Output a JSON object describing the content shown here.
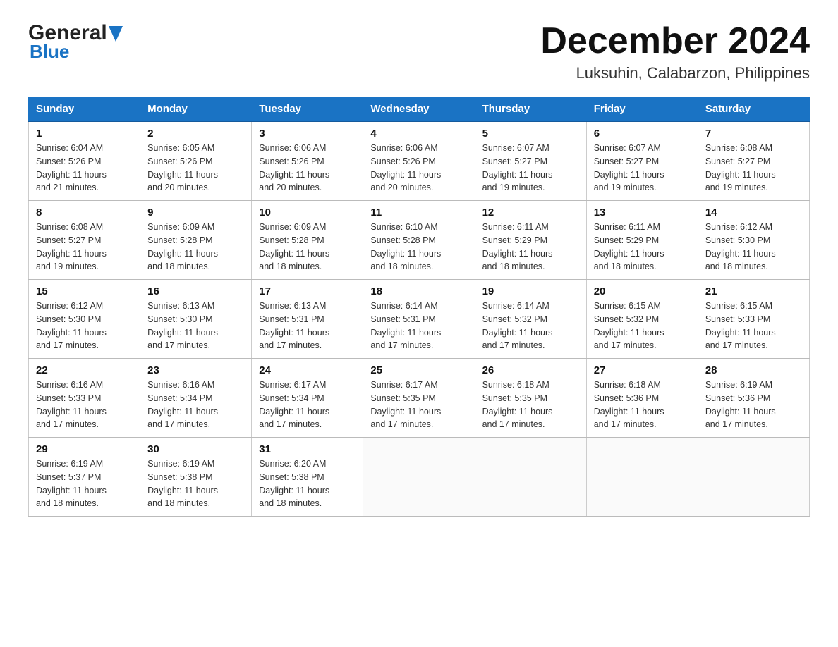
{
  "header": {
    "logo_general": "General",
    "logo_blue": "Blue",
    "title": "December 2024",
    "subtitle": "Luksuhin, Calabarzon, Philippines"
  },
  "days": [
    "Sunday",
    "Monday",
    "Tuesday",
    "Wednesday",
    "Thursday",
    "Friday",
    "Saturday"
  ],
  "weeks": [
    [
      {
        "num": "1",
        "sunrise": "6:04 AM",
        "sunset": "5:26 PM",
        "daylight": "11 hours and 21 minutes."
      },
      {
        "num": "2",
        "sunrise": "6:05 AM",
        "sunset": "5:26 PM",
        "daylight": "11 hours and 20 minutes."
      },
      {
        "num": "3",
        "sunrise": "6:06 AM",
        "sunset": "5:26 PM",
        "daylight": "11 hours and 20 minutes."
      },
      {
        "num": "4",
        "sunrise": "6:06 AM",
        "sunset": "5:26 PM",
        "daylight": "11 hours and 20 minutes."
      },
      {
        "num": "5",
        "sunrise": "6:07 AM",
        "sunset": "5:27 PM",
        "daylight": "11 hours and 19 minutes."
      },
      {
        "num": "6",
        "sunrise": "6:07 AM",
        "sunset": "5:27 PM",
        "daylight": "11 hours and 19 minutes."
      },
      {
        "num": "7",
        "sunrise": "6:08 AM",
        "sunset": "5:27 PM",
        "daylight": "11 hours and 19 minutes."
      }
    ],
    [
      {
        "num": "8",
        "sunrise": "6:08 AM",
        "sunset": "5:27 PM",
        "daylight": "11 hours and 19 minutes."
      },
      {
        "num": "9",
        "sunrise": "6:09 AM",
        "sunset": "5:28 PM",
        "daylight": "11 hours and 18 minutes."
      },
      {
        "num": "10",
        "sunrise": "6:09 AM",
        "sunset": "5:28 PM",
        "daylight": "11 hours and 18 minutes."
      },
      {
        "num": "11",
        "sunrise": "6:10 AM",
        "sunset": "5:28 PM",
        "daylight": "11 hours and 18 minutes."
      },
      {
        "num": "12",
        "sunrise": "6:11 AM",
        "sunset": "5:29 PM",
        "daylight": "11 hours and 18 minutes."
      },
      {
        "num": "13",
        "sunrise": "6:11 AM",
        "sunset": "5:29 PM",
        "daylight": "11 hours and 18 minutes."
      },
      {
        "num": "14",
        "sunrise": "6:12 AM",
        "sunset": "5:30 PM",
        "daylight": "11 hours and 18 minutes."
      }
    ],
    [
      {
        "num": "15",
        "sunrise": "6:12 AM",
        "sunset": "5:30 PM",
        "daylight": "11 hours and 17 minutes."
      },
      {
        "num": "16",
        "sunrise": "6:13 AM",
        "sunset": "5:30 PM",
        "daylight": "11 hours and 17 minutes."
      },
      {
        "num": "17",
        "sunrise": "6:13 AM",
        "sunset": "5:31 PM",
        "daylight": "11 hours and 17 minutes."
      },
      {
        "num": "18",
        "sunrise": "6:14 AM",
        "sunset": "5:31 PM",
        "daylight": "11 hours and 17 minutes."
      },
      {
        "num": "19",
        "sunrise": "6:14 AM",
        "sunset": "5:32 PM",
        "daylight": "11 hours and 17 minutes."
      },
      {
        "num": "20",
        "sunrise": "6:15 AM",
        "sunset": "5:32 PM",
        "daylight": "11 hours and 17 minutes."
      },
      {
        "num": "21",
        "sunrise": "6:15 AM",
        "sunset": "5:33 PM",
        "daylight": "11 hours and 17 minutes."
      }
    ],
    [
      {
        "num": "22",
        "sunrise": "6:16 AM",
        "sunset": "5:33 PM",
        "daylight": "11 hours and 17 minutes."
      },
      {
        "num": "23",
        "sunrise": "6:16 AM",
        "sunset": "5:34 PM",
        "daylight": "11 hours and 17 minutes."
      },
      {
        "num": "24",
        "sunrise": "6:17 AM",
        "sunset": "5:34 PM",
        "daylight": "11 hours and 17 minutes."
      },
      {
        "num": "25",
        "sunrise": "6:17 AM",
        "sunset": "5:35 PM",
        "daylight": "11 hours and 17 minutes."
      },
      {
        "num": "26",
        "sunrise": "6:18 AM",
        "sunset": "5:35 PM",
        "daylight": "11 hours and 17 minutes."
      },
      {
        "num": "27",
        "sunrise": "6:18 AM",
        "sunset": "5:36 PM",
        "daylight": "11 hours and 17 minutes."
      },
      {
        "num": "28",
        "sunrise": "6:19 AM",
        "sunset": "5:36 PM",
        "daylight": "11 hours and 17 minutes."
      }
    ],
    [
      {
        "num": "29",
        "sunrise": "6:19 AM",
        "sunset": "5:37 PM",
        "daylight": "11 hours and 18 minutes."
      },
      {
        "num": "30",
        "sunrise": "6:19 AM",
        "sunset": "5:38 PM",
        "daylight": "11 hours and 18 minutes."
      },
      {
        "num": "31",
        "sunrise": "6:20 AM",
        "sunset": "5:38 PM",
        "daylight": "11 hours and 18 minutes."
      },
      null,
      null,
      null,
      null
    ]
  ],
  "labels": {
    "sunrise": "Sunrise:",
    "sunset": "Sunset:",
    "daylight": "Daylight:"
  }
}
